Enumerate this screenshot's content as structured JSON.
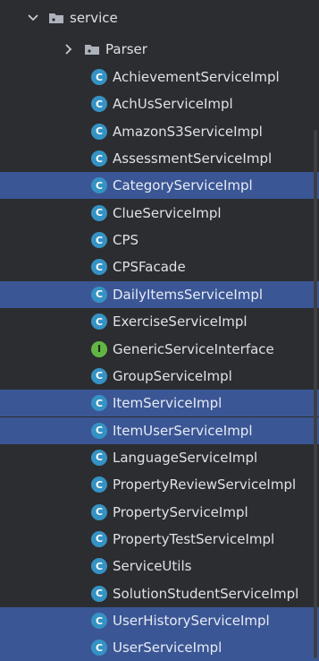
{
  "tree": {
    "service_folder": {
      "label": "service",
      "icon": "chevron-down-icon",
      "folder_icon": "package-folder-icon"
    },
    "parser_folder": {
      "label": "Parser",
      "icon": "chevron-right-icon",
      "folder_icon": "package-folder-icon"
    },
    "items": [
      {
        "label": "AchievementServiceImpl",
        "kind": "class",
        "selected": false
      },
      {
        "label": "AchUsServiceImpl",
        "kind": "class",
        "selected": false
      },
      {
        "label": "AmazonS3ServiceImpl",
        "kind": "class",
        "selected": false
      },
      {
        "label": "AssessmentServiceImpl",
        "kind": "class",
        "selected": false
      },
      {
        "label": "CategoryServiceImpl",
        "kind": "class",
        "selected": true
      },
      {
        "label": "ClueServiceImpl",
        "kind": "class",
        "selected": false
      },
      {
        "label": "CPS",
        "kind": "class",
        "selected": false
      },
      {
        "label": "CPSFacade",
        "kind": "class",
        "selected": false
      },
      {
        "label": "DailyItemsServiceImpl",
        "kind": "class",
        "selected": true
      },
      {
        "label": "ExerciseServiceImpl",
        "kind": "class",
        "selected": false
      },
      {
        "label": "GenericServiceInterface",
        "kind": "interface",
        "selected": false
      },
      {
        "label": "GroupServiceImpl",
        "kind": "class",
        "selected": false
      },
      {
        "label": "ItemServiceImpl",
        "kind": "class",
        "selected": true
      },
      {
        "label": "ItemUserServiceImpl",
        "kind": "class",
        "selected": true
      },
      {
        "label": "LanguageServiceImpl",
        "kind": "class",
        "selected": false
      },
      {
        "label": "PropertyReviewServiceImpl",
        "kind": "class",
        "selected": false
      },
      {
        "label": "PropertyServiceImpl",
        "kind": "class",
        "selected": false
      },
      {
        "label": "PropertyTestServiceImpl",
        "kind": "class",
        "selected": false
      },
      {
        "label": "ServiceUtils",
        "kind": "class",
        "selected": false
      },
      {
        "label": "SolutionStudentServiceImpl",
        "kind": "class",
        "selected": false
      },
      {
        "label": "UserHistoryServiceImpl",
        "kind": "class",
        "selected": true
      },
      {
        "label": "UserServiceImpl",
        "kind": "class",
        "selected": true
      }
    ],
    "icon_letters": {
      "class": "C",
      "interface": "I"
    }
  },
  "colors": {
    "background": "#2b2d30",
    "selection": "#3b5694",
    "text": "#dfe1e5",
    "class_icon": "#3592c4",
    "interface_icon": "#62b543"
  }
}
